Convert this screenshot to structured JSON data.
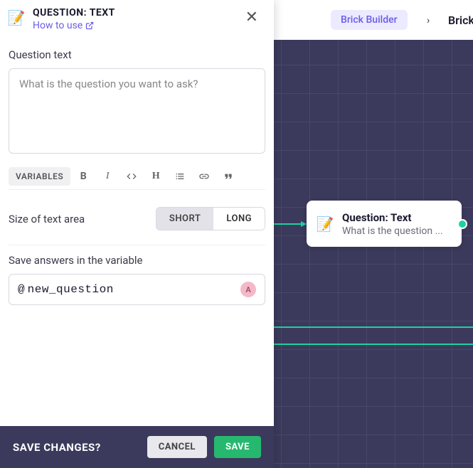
{
  "breadcrumb": {
    "builder": "Brick Builder",
    "sep": "›",
    "next": "Brick"
  },
  "node": {
    "icon": "📝",
    "title": "Question: Text",
    "subtitle": "What is the question ..."
  },
  "panel": {
    "icon": "📝",
    "title": "QUESTION: TEXT",
    "help_text": "How to use",
    "question_label": "Question text",
    "question_placeholder": "What is the question you want to ask?",
    "toolbar": {
      "variables": "VARIABLES"
    },
    "size": {
      "label": "Size of text area",
      "short": "SHORT",
      "long": "LONG"
    },
    "save_var": {
      "label": "Save answers in the variable",
      "prefix": "@",
      "name": "new_question",
      "badge": "A"
    }
  },
  "footer": {
    "title": "SAVE CHANGES?",
    "cancel": "CANCEL",
    "save": "SAVE"
  }
}
